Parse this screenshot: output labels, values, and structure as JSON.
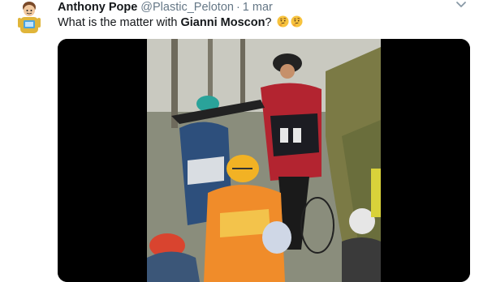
{
  "tweet": {
    "display_name": "Anthony Pope",
    "handle": "@Plastic_Peloton",
    "separator": "·",
    "timestamp": "1 mar",
    "text_before": "What is the matter with ",
    "text_bold": "Gianni Moscon",
    "text_after": "?",
    "emojis": [
      "thinking-face",
      "thinking-face"
    ]
  },
  "media": {
    "type": "video",
    "description_icons": [
      "cyclists-in-peloton"
    ]
  }
}
